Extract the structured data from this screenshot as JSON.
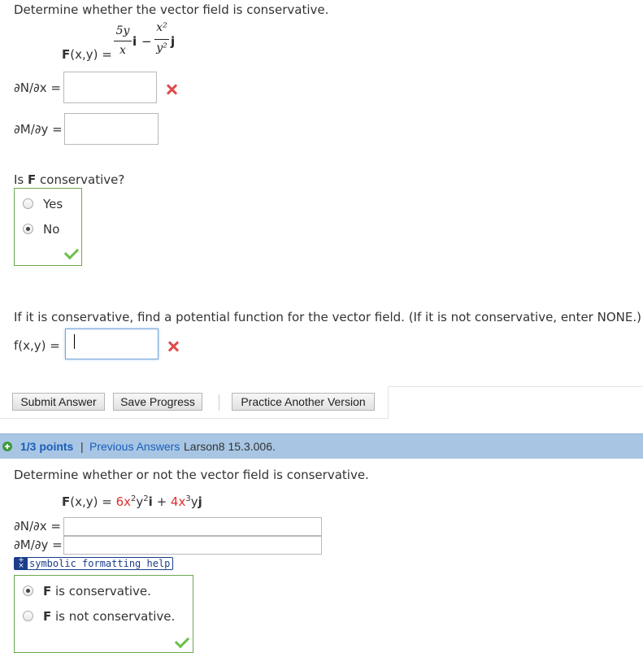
{
  "q1": {
    "prompt": "Determine whether the vector field is conservative.",
    "field_label": "F",
    "field_args": "(x,y) =",
    "term1_num": "5y",
    "term1_den": "x",
    "term1_vec": "i",
    "minus": "−",
    "term2_num": "x²",
    "term2_den": "y²",
    "term2_vec": "j",
    "dn_label": "∂N/∂x =",
    "dm_label": "∂M/∂y =",
    "is_conservative_prefix": "Is ",
    "is_conservative_F": "F",
    "is_conservative_suffix": " conservative?",
    "options": [
      "Yes",
      "No"
    ],
    "potential_prompt": "If it is conservative, find a potential function for the vector field. (If it is not conservative, enter NONE.)",
    "potential_label": "f(x,y) =",
    "buttons": {
      "submit": "Submit Answer",
      "save": "Save Progress",
      "practice": "Practice Another Version"
    }
  },
  "q2_header": {
    "points": "1/3 points",
    "separator": "|",
    "previous": "Previous Answers",
    "source": "Larson8 15.3.006."
  },
  "q2": {
    "prompt": "Determine whether or not the vector field is conservative.",
    "field_label": "F",
    "field_args": "(x,y) =",
    "term1_coef": "6x",
    "term1_exp1": "2",
    "term1_mid": "y",
    "term1_exp2": "2",
    "term1_vec": "i",
    "plus": " + ",
    "term2_coef": "4x",
    "term2_exp": "3",
    "term2_mid": "y",
    "term2_vec": "j",
    "dn_label": "∂N/∂x =",
    "dm_label": "∂M/∂y =",
    "help_link": "symbolic formatting help",
    "option1_F": "F",
    "option1_rest": " is conservative.",
    "option2_F": "F",
    "option2_rest": " is not conservative."
  },
  "colors": {
    "incorrect": "#e04a4a",
    "correct": "#6cbf4a",
    "header_bg": "#a8c6e4",
    "link": "#1a5eb8"
  },
  "icons": [
    "incorrect-x-icon",
    "correct-check-icon",
    "plus-circle-icon",
    "symbolic-help-icon"
  ]
}
